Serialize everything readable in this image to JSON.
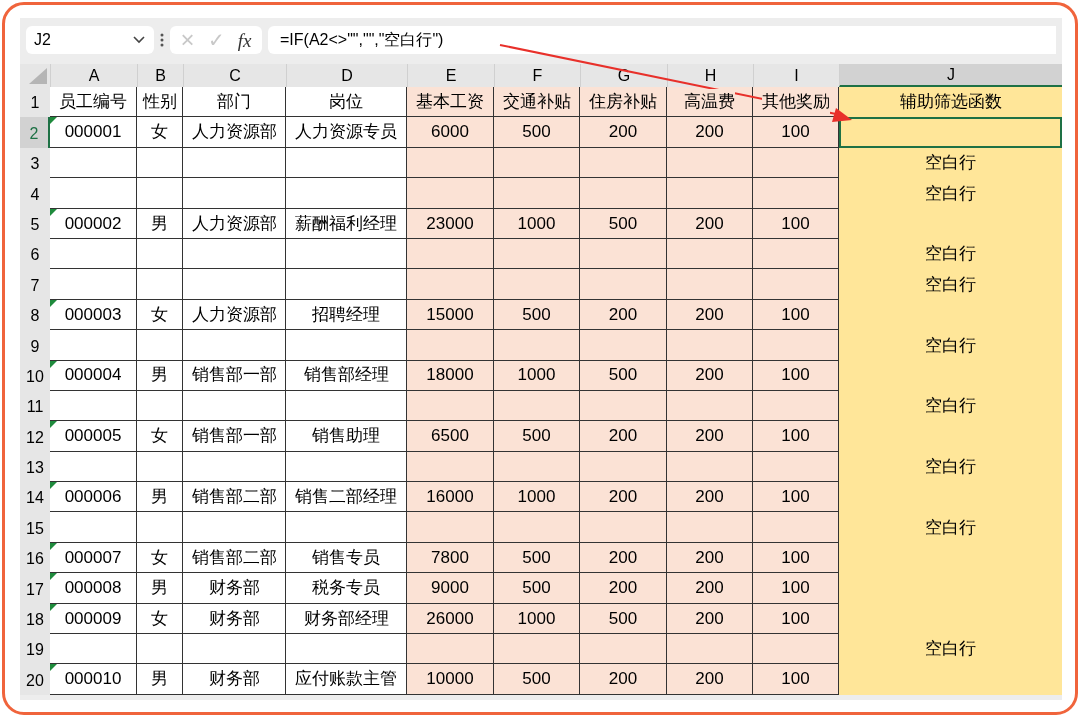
{
  "formula_bar": {
    "name_box": "J2",
    "cancel": "×",
    "enter": "✓",
    "fx": "fx",
    "formula": "=IF(A2<>\"\",\"\",\"空白行\")"
  },
  "columns": [
    {
      "letter": "A",
      "selected": false,
      "color": "#ffffff"
    },
    {
      "letter": "B",
      "selected": false,
      "color": "#ffffff"
    },
    {
      "letter": "C",
      "selected": false,
      "color": "#ffffff"
    },
    {
      "letter": "D",
      "selected": false,
      "color": "#ffffff"
    },
    {
      "letter": "E",
      "selected": false,
      "color": "#fbe2d5"
    },
    {
      "letter": "F",
      "selected": false,
      "color": "#fbe2d5"
    },
    {
      "letter": "G",
      "selected": false,
      "color": "#fbe2d5"
    },
    {
      "letter": "H",
      "selected": false,
      "color": "#fbe2d5"
    },
    {
      "letter": "I",
      "selected": false,
      "color": "#fbe2d5"
    },
    {
      "letter": "J",
      "selected": true,
      "color": "#ffe699"
    }
  ],
  "rows": [
    {
      "number": "1",
      "selected": false,
      "text_number_flag": false,
      "cells": [
        "员工编号",
        "性别",
        "部门",
        "岗位",
        "基本工资",
        "交通补贴",
        "住房补贴",
        "高温费",
        "其他奖励",
        "辅助筛选函数"
      ]
    },
    {
      "number": "2",
      "selected": true,
      "text_number_flag": true,
      "cells": [
        "000001",
        "女",
        "人力资源部",
        "人力资源专员",
        "6000",
        "500",
        "200",
        "200",
        "100",
        null
      ]
    },
    {
      "number": "3",
      "selected": false,
      "text_number_flag": false,
      "cells": [
        null,
        null,
        null,
        null,
        null,
        null,
        null,
        null,
        null,
        "空白行"
      ]
    },
    {
      "number": "4",
      "selected": false,
      "text_number_flag": false,
      "cells": [
        null,
        null,
        null,
        null,
        null,
        null,
        null,
        null,
        null,
        "空白行"
      ]
    },
    {
      "number": "5",
      "selected": false,
      "text_number_flag": true,
      "cells": [
        "000002",
        "男",
        "人力资源部",
        "薪酬福利经理",
        "23000",
        "1000",
        "500",
        "200",
        "100",
        null
      ]
    },
    {
      "number": "6",
      "selected": false,
      "text_number_flag": false,
      "cells": [
        null,
        null,
        null,
        null,
        null,
        null,
        null,
        null,
        null,
        "空白行"
      ]
    },
    {
      "number": "7",
      "selected": false,
      "text_number_flag": false,
      "cells": [
        null,
        null,
        null,
        null,
        null,
        null,
        null,
        null,
        null,
        "空白行"
      ]
    },
    {
      "number": "8",
      "selected": false,
      "text_number_flag": true,
      "cells": [
        "000003",
        "女",
        "人力资源部",
        "招聘经理",
        "15000",
        "500",
        "200",
        "200",
        "100",
        null
      ]
    },
    {
      "number": "9",
      "selected": false,
      "text_number_flag": false,
      "cells": [
        null,
        null,
        null,
        null,
        null,
        null,
        null,
        null,
        null,
        "空白行"
      ]
    },
    {
      "number": "10",
      "selected": false,
      "text_number_flag": true,
      "cells": [
        "000004",
        "男",
        "销售部一部",
        "销售部经理",
        "18000",
        "1000",
        "500",
        "200",
        "100",
        null
      ]
    },
    {
      "number": "11",
      "selected": false,
      "text_number_flag": false,
      "cells": [
        null,
        null,
        null,
        null,
        null,
        null,
        null,
        null,
        null,
        "空白行"
      ]
    },
    {
      "number": "12",
      "selected": false,
      "text_number_flag": true,
      "cells": [
        "000005",
        "女",
        "销售部一部",
        "销售助理",
        "6500",
        "500",
        "200",
        "200",
        "100",
        null
      ]
    },
    {
      "number": "13",
      "selected": false,
      "text_number_flag": false,
      "cells": [
        null,
        null,
        null,
        null,
        null,
        null,
        null,
        null,
        null,
        "空白行"
      ]
    },
    {
      "number": "14",
      "selected": false,
      "text_number_flag": true,
      "cells": [
        "000006",
        "男",
        "销售部二部",
        "销售二部经理",
        "16000",
        "1000",
        "200",
        "200",
        "100",
        null
      ]
    },
    {
      "number": "15",
      "selected": false,
      "text_number_flag": false,
      "cells": [
        null,
        null,
        null,
        null,
        null,
        null,
        null,
        null,
        null,
        "空白行"
      ]
    },
    {
      "number": "16",
      "selected": false,
      "text_number_flag": true,
      "cells": [
        "000007",
        "女",
        "销售部二部",
        "销售专员",
        "7800",
        "500",
        "200",
        "200",
        "100",
        null
      ]
    },
    {
      "number": "17",
      "selected": false,
      "text_number_flag": true,
      "cells": [
        "000008",
        "男",
        "财务部",
        "税务专员",
        "9000",
        "500",
        "200",
        "200",
        "100",
        null
      ]
    },
    {
      "number": "18",
      "selected": false,
      "text_number_flag": true,
      "cells": [
        "000009",
        "女",
        "财务部",
        "财务部经理",
        "26000",
        "1000",
        "500",
        "200",
        "100",
        null
      ]
    },
    {
      "number": "19",
      "selected": false,
      "text_number_flag": false,
      "cells": [
        null,
        null,
        null,
        null,
        null,
        null,
        null,
        null,
        null,
        "空白行"
      ]
    },
    {
      "number": "20",
      "selected": false,
      "text_number_flag": true,
      "cells": [
        "000010",
        "男",
        "财务部",
        "应付账款主管",
        "10000",
        "500",
        "200",
        "200",
        "100",
        null
      ]
    }
  ]
}
